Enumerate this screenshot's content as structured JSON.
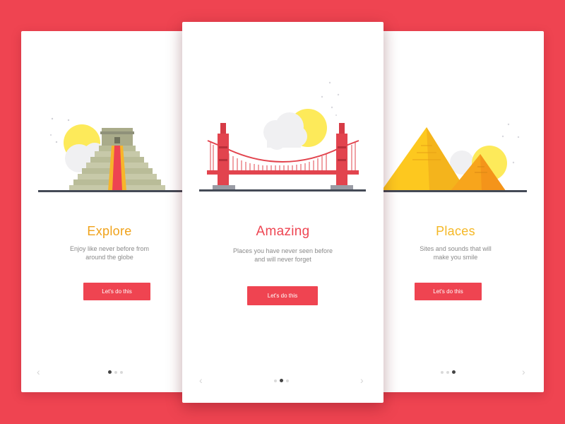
{
  "colors": {
    "background": "#ef4451",
    "button": "#ef4451",
    "title_explore": "#f0a21a",
    "title_amazing": "#ee4653",
    "title_places": "#f5b826",
    "ground": "#444a56",
    "sun": "#fdea5a"
  },
  "screens": [
    {
      "id": "explore",
      "illustration": "pyramid-temple-illustration",
      "title": "Explore",
      "description": "Enjoy like never before from\naround the globe",
      "cta_label": "Let's do this",
      "active_dot": 1,
      "dot_count": 3
    },
    {
      "id": "amazing",
      "illustration": "golden-gate-bridge-illustration",
      "title": "Amazing",
      "description": "Places you have never seen before\nand will never forget",
      "cta_label": "Let's do this",
      "active_dot": 2,
      "dot_count": 3
    },
    {
      "id": "places",
      "illustration": "egypt-pyramids-illustration",
      "title": "Places",
      "description": "Sites and sounds that will\nmake you smile",
      "cta_label": "Let's do this",
      "active_dot": 3,
      "dot_count": 3
    }
  ],
  "icons": {
    "prev": "chevron-left-icon",
    "next": "chevron-right-icon"
  }
}
